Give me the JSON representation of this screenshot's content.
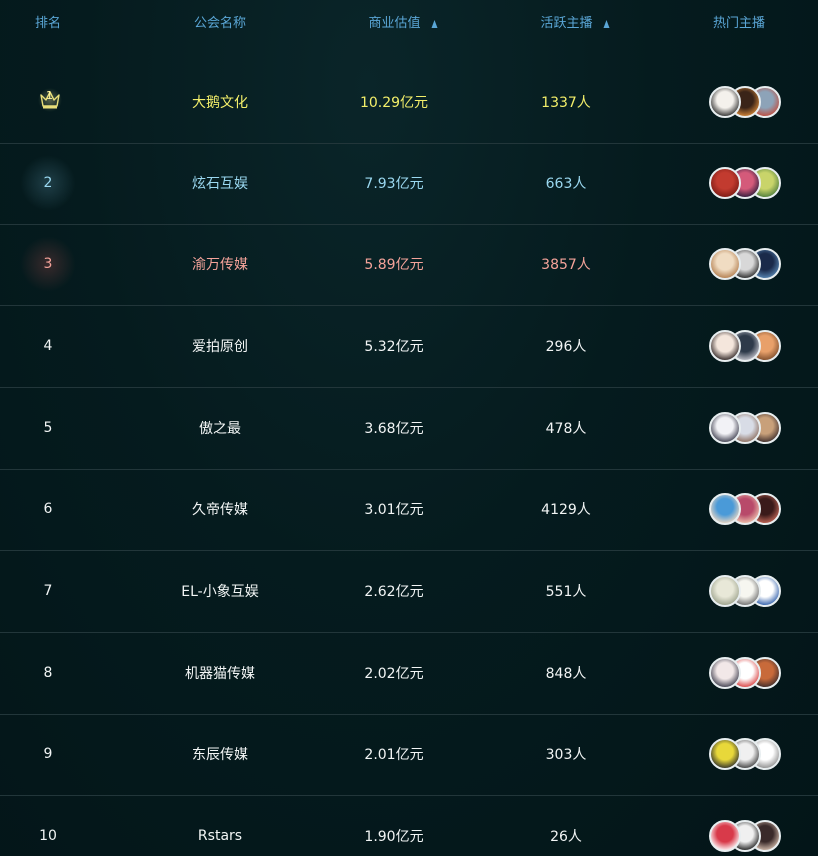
{
  "header": {
    "rank": "排名",
    "guild_name": "公会名称",
    "valuation": "商业估值",
    "active_hosts": "活跃主播",
    "hot_hosts": "热门主播"
  },
  "rows": [
    {
      "rank": "1",
      "name": "大鹅文化",
      "valuation": "10.29亿元",
      "active": "1337人",
      "tier": "gold",
      "avatars": [
        [
          "#f4f1ec",
          "#2a2a2a"
        ],
        [
          "#3a2418",
          "#d98a3a"
        ],
        [
          "#8da3b8",
          "#c24a3a"
        ]
      ]
    },
    {
      "rank": "2",
      "name": "炫石互娱",
      "valuation": "7.93亿元",
      "active": "663人",
      "tier": "silver",
      "avatars": [
        [
          "#c23b2f",
          "#7a1a14"
        ],
        [
          "#d45a7a",
          "#2a1a3a"
        ],
        [
          "#c9d46a",
          "#4a7a3a"
        ]
      ]
    },
    {
      "rank": "3",
      "name": "渝万传媒",
      "valuation": "5.89亿元",
      "active": "3857人",
      "tier": "bronze",
      "avatars": [
        [
          "#f0dcc2",
          "#b07a4a"
        ],
        [
          "#d8d8d8",
          "#222222"
        ],
        [
          "#1a2a4a",
          "#5a8ab8"
        ]
      ]
    },
    {
      "rank": "4",
      "name": "爱拍原创",
      "valuation": "5.32亿元",
      "active": "296人",
      "tier": "",
      "avatars": [
        [
          "#f4e6dc",
          "#2a2020"
        ],
        [
          "#2e3a4a",
          "#c8c8d0"
        ],
        [
          "#e8a06a",
          "#7a4a2a"
        ]
      ]
    },
    {
      "rank": "5",
      "name": "傲之最",
      "valuation": "3.68亿元",
      "active": "478人",
      "tier": "",
      "avatars": [
        [
          "#f2f2f6",
          "#3a3a4a"
        ],
        [
          "#d8dce6",
          "#8a6a5a"
        ],
        [
          "#c8a07a",
          "#3a2a2a"
        ]
      ]
    },
    {
      "rank": "6",
      "name": "久帝传媒",
      "valuation": "3.01亿元",
      "active": "4129人",
      "tier": "",
      "avatars": [
        [
          "#4a9ad8",
          "#f0d8c0"
        ],
        [
          "#b84a6a",
          "#f0c8b0"
        ],
        [
          "#3a1a1a",
          "#c86a5a"
        ]
      ]
    },
    {
      "rank": "7",
      "name": "EL-小象互娱",
      "valuation": "2.62亿元",
      "active": "551人",
      "tier": "",
      "avatars": [
        [
          "#e8e8d8",
          "#9aa08a"
        ],
        [
          "#f6f6f0",
          "#6a6a6a"
        ],
        [
          "#ffffff",
          "#2a5aa8"
        ]
      ]
    },
    {
      "rank": "8",
      "name": "机器猫传媒",
      "valuation": "2.02亿元",
      "active": "848人",
      "tier": "",
      "avatars": [
        [
          "#f2e8e8",
          "#3a3a4a"
        ],
        [
          "#ffffff",
          "#d83a3a"
        ],
        [
          "#c86a3a",
          "#3a2a2a"
        ]
      ]
    },
    {
      "rank": "9",
      "name": "东辰传媒",
      "valuation": "2.01亿元",
      "active": "303人",
      "tier": "",
      "avatars": [
        [
          "#e8d83a",
          "#2a2a2a"
        ],
        [
          "#f0f0f0",
          "#3a3a3a"
        ],
        [
          "#ffffff",
          "#8a8a8a"
        ]
      ]
    },
    {
      "rank": "10",
      "name": "Rstars",
      "valuation": "1.90亿元",
      "active": "26人",
      "tier": "",
      "avatars": [
        [
          "#d83a4a",
          "#ffffff"
        ],
        [
          "#f0f0f0",
          "#1a1a1a"
        ],
        [
          "#3a2a2a",
          "#d8c0b0"
        ]
      ]
    }
  ]
}
